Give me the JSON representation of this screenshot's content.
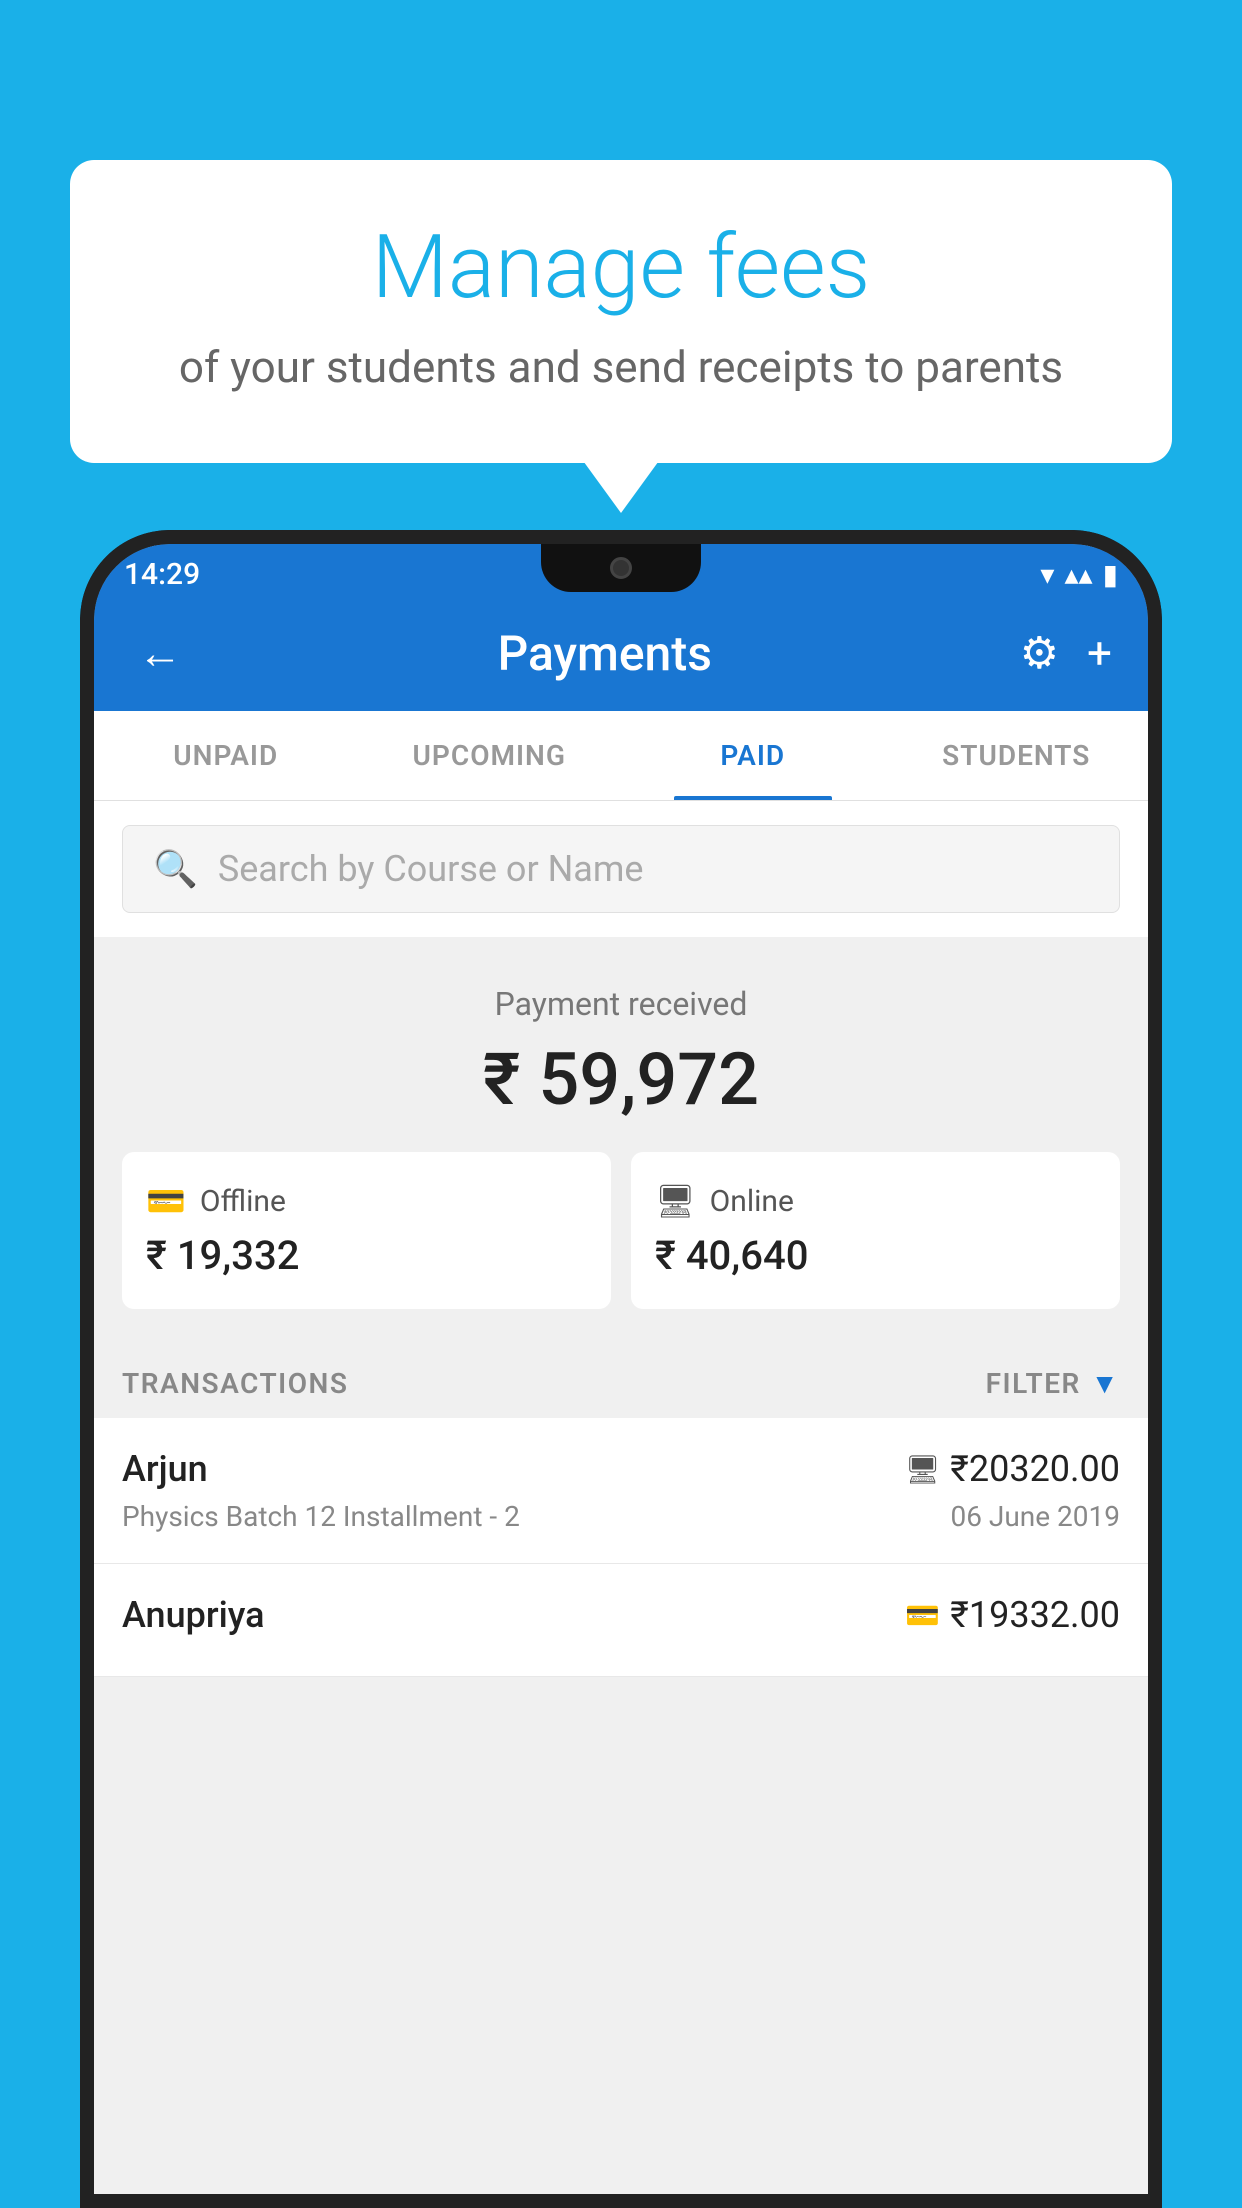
{
  "background_color": "#1ab0e8",
  "speech_bubble": {
    "headline": "Manage fees",
    "subtext": "of your students and send receipts to parents"
  },
  "status_bar": {
    "time": "14:29",
    "wifi": "▾",
    "signal": "▾",
    "battery": "▮"
  },
  "app": {
    "title": "Payments",
    "back_label": "←",
    "gear_label": "⚙",
    "plus_label": "+",
    "tabs": [
      {
        "id": "unpaid",
        "label": "UNPAID",
        "active": false
      },
      {
        "id": "upcoming",
        "label": "UPCOMING",
        "active": false
      },
      {
        "id": "paid",
        "label": "PAID",
        "active": true
      },
      {
        "id": "students",
        "label": "STUDENTS",
        "active": false
      }
    ],
    "search": {
      "placeholder": "Search by Course or Name"
    },
    "payment_received": {
      "label": "Payment received",
      "amount": "₹ 59,972",
      "offline": {
        "type": "Offline",
        "amount": "₹ 19,332"
      },
      "online": {
        "type": "Online",
        "amount": "₹ 40,640"
      }
    },
    "transactions_section": {
      "label": "TRANSACTIONS",
      "filter_label": "FILTER"
    },
    "transactions": [
      {
        "name": "Arjun",
        "course": "Physics Batch 12 Installment - 2",
        "amount": "₹20320.00",
        "date": "06 June 2019",
        "payment_type": "online"
      },
      {
        "name": "Anupriya",
        "course": "",
        "amount": "₹19332.00",
        "date": "",
        "payment_type": "offline"
      }
    ]
  }
}
